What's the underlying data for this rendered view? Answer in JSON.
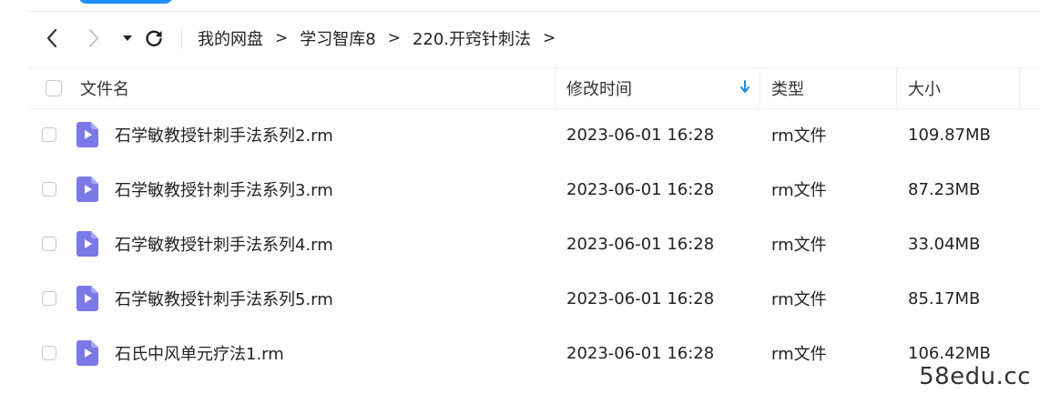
{
  "toolbar": {
    "back_icon": "chevron-left-icon",
    "forward_icon": "chevron-right-icon",
    "dropdown_icon": "caret-down-icon",
    "refresh_icon": "refresh-icon"
  },
  "breadcrumb": {
    "items": [
      "我的网盘",
      "学习智库8",
      "220.开窍针刺法"
    ],
    "separator": ">"
  },
  "table": {
    "columns": {
      "name": "文件名",
      "modified": "修改时间",
      "type": "类型",
      "size": "大小"
    },
    "sort_icon": "arrow-down-icon",
    "rows": [
      {
        "name": "石学敏教授针刺手法系列2.rm",
        "modified": "2023-06-01 16:28",
        "type": "rm文件",
        "size": "109.87MB"
      },
      {
        "name": "石学敏教授针刺手法系列3.rm",
        "modified": "2023-06-01 16:28",
        "type": "rm文件",
        "size": "87.23MB"
      },
      {
        "name": "石学敏教授针刺手法系列4.rm",
        "modified": "2023-06-01 16:28",
        "type": "rm文件",
        "size": "33.04MB"
      },
      {
        "name": "石学敏教授针刺手法系列5.rm",
        "modified": "2023-06-01 16:28",
        "type": "rm文件",
        "size": "85.17MB"
      },
      {
        "name": "石氏中风单元疗法1.rm",
        "modified": "2023-06-01 16:28",
        "type": "rm文件",
        "size": "106.42MB"
      }
    ]
  },
  "colors": {
    "accent": "#1e90ff",
    "file_icon": "#7b78e8",
    "sort_arrow": "#1e88e5"
  },
  "watermark": "58edu.cc"
}
